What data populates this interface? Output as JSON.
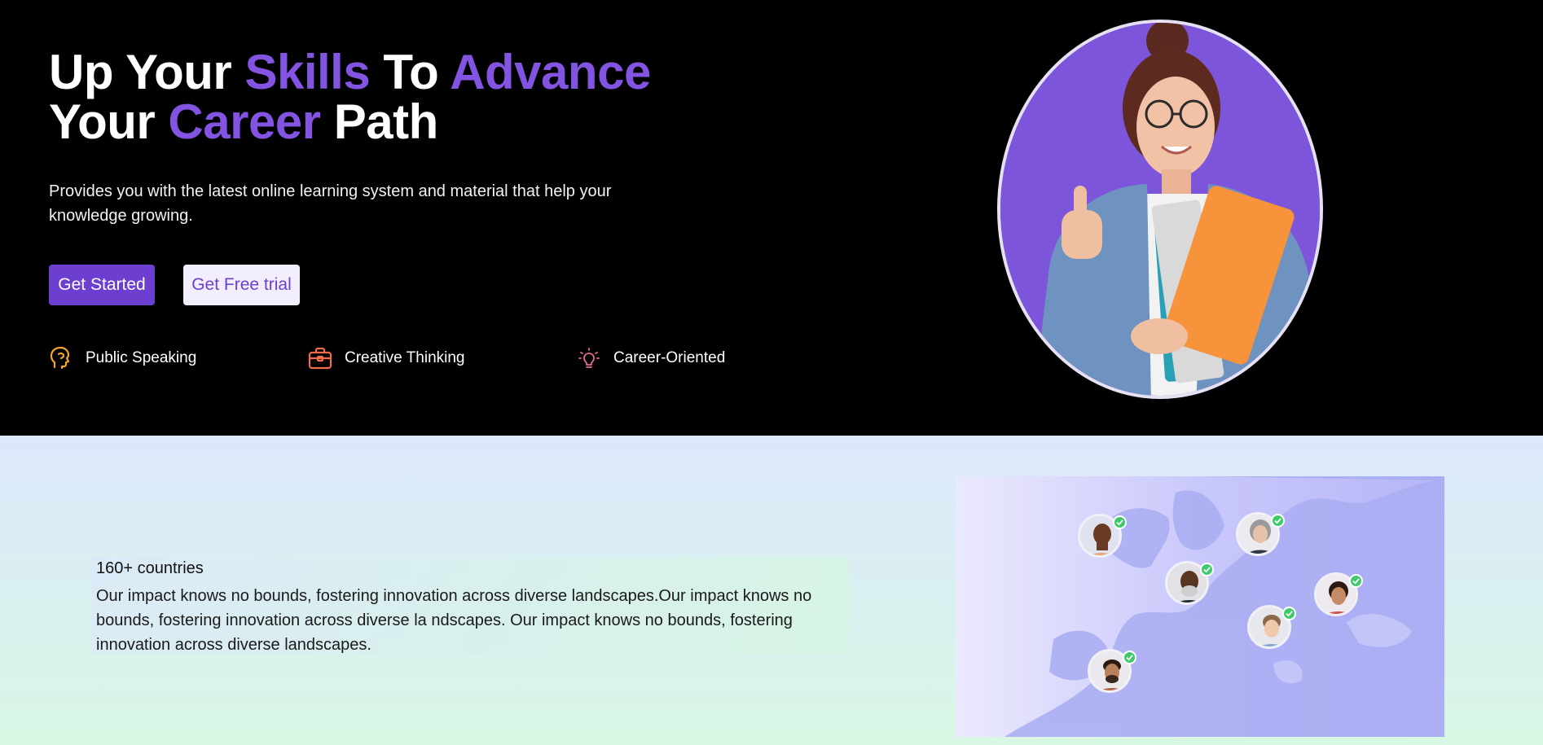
{
  "hero": {
    "title_parts": [
      "Up Your ",
      "Skills",
      " To ",
      "Advance",
      "Your ",
      "Career",
      " Path"
    ],
    "description": "Provides you with the latest online learning system and material that help your knowledge growing.",
    "primary_button": "Get Started",
    "secondary_button": "Get Free trial",
    "features": [
      {
        "label": "Public Speaking",
        "icon": "speaking-head-icon",
        "color": "#f5a623"
      },
      {
        "label": "Creative Thinking",
        "icon": "briefcase-icon",
        "color": "#f26b4a"
      },
      {
        "label": "Career-Oriented",
        "icon": "lightbulb-icon",
        "color": "#e86a8c"
      }
    ],
    "portrait_icon": "student-photo",
    "accent_color": "#8353e2"
  },
  "impact": {
    "title": "160+ countries",
    "text": "Our impact knows no bounds, fostering innovation across diverse landscapes.Our impact knows no bounds, fostering innovation across diverse la ndscapes. Our impact knows no bounds, fostering innovation across diverse landscapes.",
    "map_icon": "europe-map",
    "avatar_count": 6
  }
}
